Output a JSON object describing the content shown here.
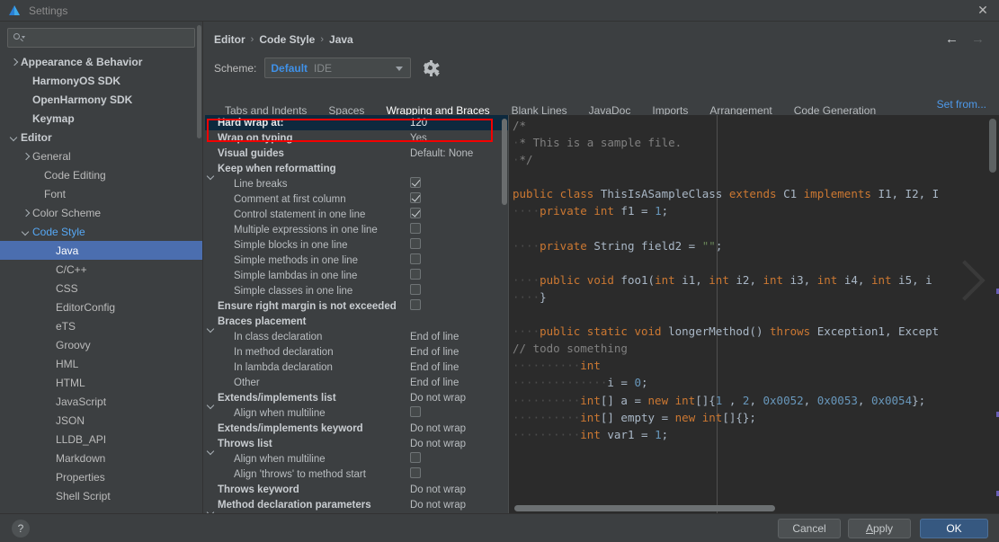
{
  "window": {
    "title": "Settings",
    "logo_icon": "harmonyos-logo-icon",
    "close_icon": "✕"
  },
  "sidebar": {
    "search": {
      "placeholder": "",
      "value": "",
      "icon": "search-icon"
    },
    "items": [
      {
        "label": "Appearance & Behavior",
        "arrow": "right",
        "indent": 0,
        "bold": true,
        "selected": false,
        "accent": false
      },
      {
        "label": "HarmonyOS SDK",
        "arrow": "none",
        "indent": 1,
        "bold": true,
        "selected": false,
        "accent": false
      },
      {
        "label": "OpenHarmony SDK",
        "arrow": "none",
        "indent": 1,
        "bold": true,
        "selected": false,
        "accent": false
      },
      {
        "label": "Keymap",
        "arrow": "none",
        "indent": 1,
        "bold": true,
        "selected": false,
        "accent": false
      },
      {
        "label": "Editor",
        "arrow": "down",
        "indent": 0,
        "bold": true,
        "selected": false,
        "accent": false
      },
      {
        "label": "General",
        "arrow": "right",
        "indent": 1,
        "bold": false,
        "selected": false,
        "accent": false
      },
      {
        "label": "Code Editing",
        "arrow": "none",
        "indent": 2,
        "bold": false,
        "selected": false,
        "accent": false
      },
      {
        "label": "Font",
        "arrow": "none",
        "indent": 2,
        "bold": false,
        "selected": false,
        "accent": false
      },
      {
        "label": "Color Scheme",
        "arrow": "right",
        "indent": 1,
        "bold": false,
        "selected": false,
        "accent": false
      },
      {
        "label": "Code Style",
        "arrow": "down",
        "indent": 1,
        "bold": false,
        "selected": false,
        "accent": true
      },
      {
        "label": "Java",
        "arrow": "none",
        "indent": 3,
        "bold": false,
        "selected": true,
        "accent": false
      },
      {
        "label": "C/C++",
        "arrow": "none",
        "indent": 3,
        "bold": false,
        "selected": false,
        "accent": false
      },
      {
        "label": "CSS",
        "arrow": "none",
        "indent": 3,
        "bold": false,
        "selected": false,
        "accent": false
      },
      {
        "label": "EditorConfig",
        "arrow": "none",
        "indent": 3,
        "bold": false,
        "selected": false,
        "accent": false
      },
      {
        "label": "eTS",
        "arrow": "none",
        "indent": 3,
        "bold": false,
        "selected": false,
        "accent": false
      },
      {
        "label": "Groovy",
        "arrow": "none",
        "indent": 3,
        "bold": false,
        "selected": false,
        "accent": false
      },
      {
        "label": "HML",
        "arrow": "none",
        "indent": 3,
        "bold": false,
        "selected": false,
        "accent": false
      },
      {
        "label": "HTML",
        "arrow": "none",
        "indent": 3,
        "bold": false,
        "selected": false,
        "accent": false
      },
      {
        "label": "JavaScript",
        "arrow": "none",
        "indent": 3,
        "bold": false,
        "selected": false,
        "accent": false
      },
      {
        "label": "JSON",
        "arrow": "none",
        "indent": 3,
        "bold": false,
        "selected": false,
        "accent": false
      },
      {
        "label": "LLDB_API",
        "arrow": "none",
        "indent": 3,
        "bold": false,
        "selected": false,
        "accent": false
      },
      {
        "label": "Markdown",
        "arrow": "none",
        "indent": 3,
        "bold": false,
        "selected": false,
        "accent": false
      },
      {
        "label": "Properties",
        "arrow": "none",
        "indent": 3,
        "bold": false,
        "selected": false,
        "accent": false
      },
      {
        "label": "Shell Script",
        "arrow": "none",
        "indent": 3,
        "bold": false,
        "selected": false,
        "accent": false
      }
    ]
  },
  "header": {
    "breadcrumb": [
      "Editor",
      "Code Style",
      "Java"
    ],
    "separator": "›",
    "back_arrow": "←",
    "forward_arrow": "→",
    "scheme_label": "Scheme:",
    "scheme_value": "Default",
    "scheme_sub": "IDE",
    "gear_icon": "gear-icon",
    "set_from": "Set from..."
  },
  "tabs": [
    {
      "label": "Tabs and Indents",
      "active": false
    },
    {
      "label": "Spaces",
      "active": false
    },
    {
      "label": "Wrapping and Braces",
      "active": true
    },
    {
      "label": "Blank Lines",
      "active": false
    },
    {
      "label": "JavaDoc",
      "active": false
    },
    {
      "label": "Imports",
      "active": false
    },
    {
      "label": "Arrangement",
      "active": false
    },
    {
      "label": "Code Generation",
      "active": false
    }
  ],
  "options": [
    {
      "name": "Hard wrap at:",
      "value": "120",
      "type": "text",
      "group": true,
      "expander": "none",
      "indent": 0,
      "selected": true
    },
    {
      "name": "Wrap on typing",
      "value": "Yes",
      "type": "text",
      "group": true,
      "expander": "none",
      "indent": 0,
      "selected": false
    },
    {
      "name": "Visual guides",
      "value": "Default: None",
      "type": "text",
      "group": true,
      "expander": "none",
      "indent": 0,
      "selected": false
    },
    {
      "name": "Keep when reformatting",
      "value": "",
      "type": "none",
      "group": true,
      "expander": "down",
      "indent": 0,
      "selected": false
    },
    {
      "name": "Line breaks",
      "value": "checked",
      "type": "checkbox",
      "group": false,
      "expander": "none",
      "indent": 1,
      "selected": false
    },
    {
      "name": "Comment at first column",
      "value": "checked",
      "type": "checkbox",
      "group": false,
      "expander": "none",
      "indent": 1,
      "selected": false
    },
    {
      "name": "Control statement in one line",
      "value": "checked",
      "type": "checkbox",
      "group": false,
      "expander": "none",
      "indent": 1,
      "selected": false
    },
    {
      "name": "Multiple expressions in one line",
      "value": "unchecked",
      "type": "checkbox",
      "group": false,
      "expander": "none",
      "indent": 1,
      "selected": false
    },
    {
      "name": "Simple blocks in one line",
      "value": "unchecked",
      "type": "checkbox",
      "group": false,
      "expander": "none",
      "indent": 1,
      "selected": false
    },
    {
      "name": "Simple methods in one line",
      "value": "unchecked",
      "type": "checkbox",
      "group": false,
      "expander": "none",
      "indent": 1,
      "selected": false
    },
    {
      "name": "Simple lambdas in one line",
      "value": "unchecked",
      "type": "checkbox",
      "group": false,
      "expander": "none",
      "indent": 1,
      "selected": false
    },
    {
      "name": "Simple classes in one line",
      "value": "unchecked",
      "type": "checkbox",
      "group": false,
      "expander": "none",
      "indent": 1,
      "selected": false
    },
    {
      "name": "Ensure right margin is not exceeded",
      "value": "unchecked",
      "type": "checkbox",
      "group": true,
      "expander": "none",
      "indent": 0,
      "selected": false
    },
    {
      "name": "Braces placement",
      "value": "",
      "type": "none",
      "group": true,
      "expander": "down",
      "indent": 0,
      "selected": false
    },
    {
      "name": "In class declaration",
      "value": "End of line",
      "type": "text",
      "group": false,
      "expander": "none",
      "indent": 1,
      "selected": false
    },
    {
      "name": "In method declaration",
      "value": "End of line",
      "type": "text",
      "group": false,
      "expander": "none",
      "indent": 1,
      "selected": false
    },
    {
      "name": "In lambda declaration",
      "value": "End of line",
      "type": "text",
      "group": false,
      "expander": "none",
      "indent": 1,
      "selected": false
    },
    {
      "name": "Other",
      "value": "End of line",
      "type": "text",
      "group": false,
      "expander": "none",
      "indent": 1,
      "selected": false
    },
    {
      "name": "Extends/implements list",
      "value": "Do not wrap",
      "type": "text",
      "group": true,
      "expander": "down",
      "indent": 0,
      "selected": false
    },
    {
      "name": "Align when multiline",
      "value": "unchecked",
      "type": "checkbox",
      "group": false,
      "expander": "none",
      "indent": 1,
      "selected": false
    },
    {
      "name": "Extends/implements keyword",
      "value": "Do not wrap",
      "type": "text",
      "group": true,
      "expander": "none",
      "indent": 0,
      "selected": false
    },
    {
      "name": "Throws list",
      "value": "Do not wrap",
      "type": "text",
      "group": true,
      "expander": "down",
      "indent": 0,
      "selected": false
    },
    {
      "name": "Align when multiline",
      "value": "unchecked",
      "type": "checkbox",
      "group": false,
      "expander": "none",
      "indent": 1,
      "selected": false
    },
    {
      "name": "Align 'throws' to method start",
      "value": "unchecked",
      "type": "checkbox",
      "group": false,
      "expander": "none",
      "indent": 1,
      "selected": false
    },
    {
      "name": "Throws keyword",
      "value": "Do not wrap",
      "type": "text",
      "group": true,
      "expander": "none",
      "indent": 0,
      "selected": false
    },
    {
      "name": "Method declaration parameters",
      "value": "Do not wrap",
      "type": "text",
      "group": true,
      "expander": "down",
      "indent": 0,
      "selected": false
    }
  ],
  "code_preview": {
    "lines": [
      [
        [
          "c",
          "/*"
        ]
      ],
      [
        [
          "dot",
          "·"
        ],
        [
          "c",
          "* This is a sample file."
        ]
      ],
      [
        [
          "dot",
          "·"
        ],
        [
          "c",
          "*/"
        ]
      ],
      [],
      [
        [
          "k",
          "public class "
        ],
        [
          "t",
          "ThisIsASampleClass "
        ],
        [
          "k",
          "extends "
        ],
        [
          "t",
          "C1 "
        ],
        [
          "k",
          "implements "
        ],
        [
          "t",
          "I1, I2, I"
        ]
      ],
      [
        [
          "dot",
          "····"
        ],
        [
          "k",
          "private int "
        ],
        [
          "t",
          "f1 = "
        ],
        [
          "n",
          "1"
        ],
        [
          "t",
          ";"
        ]
      ],
      [],
      [
        [
          "dot",
          "····"
        ],
        [
          "k",
          "private "
        ],
        [
          "t",
          "String field2 = "
        ],
        [
          "s",
          "\"\""
        ],
        [
          "t",
          ";"
        ]
      ],
      [],
      [
        [
          "dot",
          "····"
        ],
        [
          "k",
          "public void "
        ],
        [
          "t",
          "foo1("
        ],
        [
          "k",
          "int "
        ],
        [
          "t",
          "i1, "
        ],
        [
          "k",
          "int "
        ],
        [
          "t",
          "i2, "
        ],
        [
          "k",
          "int "
        ],
        [
          "t",
          "i3, "
        ],
        [
          "k",
          "int "
        ],
        [
          "t",
          "i4, "
        ],
        [
          "k",
          "int "
        ],
        [
          "t",
          "i5, i"
        ]
      ],
      [
        [
          "dot",
          "····"
        ],
        [
          "t",
          "}"
        ]
      ],
      [],
      [
        [
          "dot",
          "····"
        ],
        [
          "k",
          "public static void "
        ],
        [
          "t",
          "longerMethod() "
        ],
        [
          "k",
          "throws "
        ],
        [
          "t",
          "Exception1, Except"
        ]
      ],
      [
        [
          "c",
          "// todo something"
        ]
      ],
      [
        [
          "dot",
          "··········"
        ],
        [
          "k",
          "int"
        ]
      ],
      [
        [
          "dot",
          "··············"
        ],
        [
          "t",
          "i = "
        ],
        [
          "n",
          "0"
        ],
        [
          "t",
          ";"
        ]
      ],
      [
        [
          "dot",
          "··········"
        ],
        [
          "k",
          "int"
        ],
        [
          "t",
          "[] a = "
        ],
        [
          "k",
          "new int"
        ],
        [
          "t",
          "[]{"
        ],
        [
          "n",
          "1"
        ],
        [
          "t",
          " , "
        ],
        [
          "n",
          "2"
        ],
        [
          "t",
          ", "
        ],
        [
          "n",
          "0x0052"
        ],
        [
          "t",
          ", "
        ],
        [
          "n",
          "0x0053"
        ],
        [
          "t",
          ", "
        ],
        [
          "n",
          "0x0054"
        ],
        [
          "t",
          "};"
        ]
      ],
      [
        [
          "dot",
          "··········"
        ],
        [
          "k",
          "int"
        ],
        [
          "t",
          "[] empty = "
        ],
        [
          "k",
          "new int"
        ],
        [
          "t",
          "[]{};"
        ]
      ],
      [
        [
          "dot",
          "··········"
        ],
        [
          "k",
          "int "
        ],
        [
          "t",
          "var1 = "
        ],
        [
          "n",
          "1"
        ],
        [
          "t",
          ";"
        ]
      ]
    ],
    "watermark_icon": "chevron-right-watermark-icon"
  },
  "footer": {
    "help_icon": "?",
    "cancel": "Cancel",
    "apply": "Apply",
    "apply_mnemonic": "A",
    "ok": "OK"
  },
  "colors": {
    "accent_blue": "#4b6eaf",
    "link_blue": "#4e9aeb",
    "highlight_red": "#f40000",
    "selected_row": "#0d293e",
    "editor_bg": "#2b2b2b",
    "panel_bg": "#3c3f41"
  }
}
